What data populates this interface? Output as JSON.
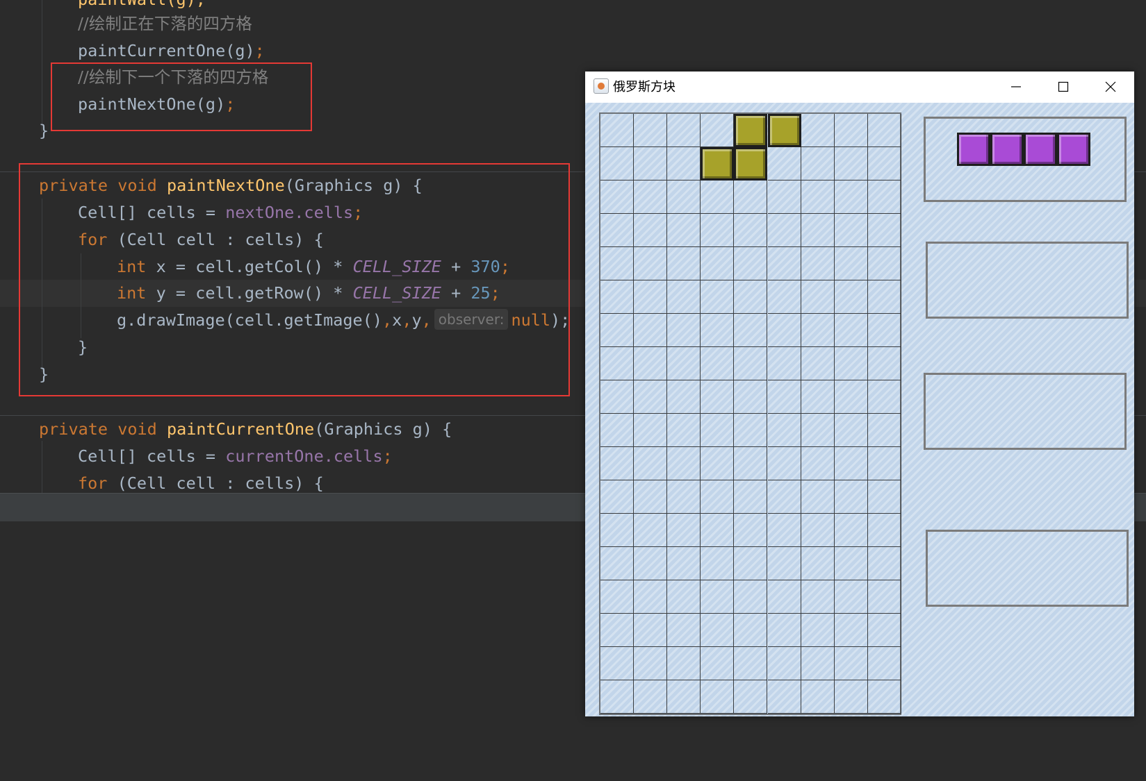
{
  "editor": {
    "line0": "paintWall(g);",
    "comment_current": "//绘制正在下落的四方格",
    "call_current": "paintCurrentOne(g)",
    "semi": ";",
    "comment_next": "//绘制下一个下落的四方格",
    "call_next": "paintNextOne(g)",
    "close_brace": "}",
    "m1_private": "private",
    "m1_void": "void",
    "m1_name": "paintNextOne",
    "m1_params": "(Graphics g) {",
    "m1_l1_type": "Cell[] cells = ",
    "m1_l1_field": "nextOne.cells",
    "m1_for": "for",
    "m1_for_rest": " (Cell cell : cells) {",
    "m1_int": "int",
    "m1_x_expr": " x = cell.getCol() * ",
    "m1_const": "CELL_SIZE",
    "m1_plus": " + ",
    "m1_x_num": "370",
    "m1_y_expr": " y = cell.getRow() * ",
    "m1_y_num": "25",
    "m1_draw_pre": "g.drawImage(cell.getImage()",
    "m1_comma": ",",
    "m1_x": "x",
    "m1_y": "y",
    "m1_hint": "observer:",
    "m1_null": "null",
    "m1_draw_post": ");",
    "m2_name": "paintCurrentOne",
    "m2_params": "(Graphics g) {",
    "m2_l1_field": "currentOne.cells"
  },
  "window": {
    "title": "俄罗斯方块",
    "app_icon": "java-cup-icon",
    "minimize_icon": "minimize-icon",
    "maximize_icon": "maximize-icon",
    "close_icon": "close-icon"
  },
  "game": {
    "rows": 18,
    "cols": 9,
    "current_piece": {
      "shape": "S",
      "cells": [
        [
          0,
          4
        ],
        [
          0,
          5
        ],
        [
          1,
          3
        ],
        [
          1,
          4
        ]
      ],
      "color": "#a7a22a"
    },
    "next_piece": {
      "shape": "I",
      "cells": [
        [
          0,
          0
        ],
        [
          0,
          1
        ],
        [
          0,
          2
        ],
        [
          0,
          3
        ]
      ],
      "color": "#a94bd6"
    }
  },
  "colors": {
    "highlight_box": "#e53935",
    "keyword": "#cc7832",
    "function": "#ffc66d",
    "field": "#9876aa",
    "number": "#6897bb"
  }
}
